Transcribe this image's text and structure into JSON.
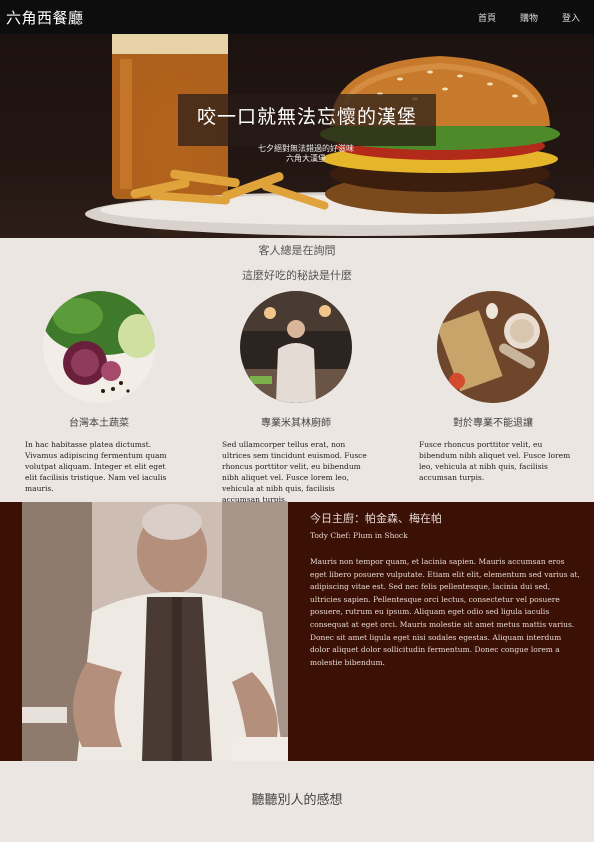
{
  "nav": {
    "brand": "六角西餐廳",
    "links": [
      "首頁",
      "購物",
      "登入"
    ]
  },
  "hero": {
    "title": "咬一口就無法忘懷的漢堡",
    "subtitle_line1": "七夕絕對無法錯過的好滋味",
    "subtitle_line2": "六角大漢堡"
  },
  "features": {
    "heading1": "客人總是在詢問",
    "heading2": "這麼好吃的秘訣是什麼",
    "items": [
      {
        "title": "台灣本土蔬菜",
        "text": "In hac habitasse platea dictumst. Vivamus adipiscing fermentum quam volutpat aliquam. Integer et elit eget elit facilisis tristique. Nam vel iaculis mauris."
      },
      {
        "title": "專業米其林廚師",
        "text": "Sed ullamcorper tellus erat, non ultrices sem tincidunt euismod. Fusce rhoncus porttitor velit, eu bibendum nibh aliquet vel. Fusce lorem leo, vehicula at nibh quis, facilisis accumsan turpis."
      },
      {
        "title": "對於專業不能退讓",
        "text": "Fusce rhoncus porttitor velit, eu bibendum nibh aliquet vel. Fusce lorem leo, vehicula at nibh quis, facilisis accumsan turpis."
      }
    ]
  },
  "chef": {
    "title": "今日主廚：帕金森、梅在帕",
    "subtitle": "Tody Chef: Plum in Shock",
    "text": "Mauris non tempor quam, et lacinia sapien. Mauris accumsan eros eget libero posuere vulputate. Etiam elit elit, elementum sed varius at, adipiscing vitae est. Sed nec felis pellentesque, lacinia dui sed, ultricies sapien. Pellentesque orci lectus, consectetur vel posuere posuere, rutrum eu ipsum. Aliquam eget odio sed ligula iaculis consequat at eget orci. Mauris molestie sit amet metus mattis varius. Donec sit amet ligula eget nisi sodales egestas. Aliquam interdum dolor aliquet dolor sollicitudin fermentum. Donec congue lorem a molestie bibendum."
  },
  "testimonials": {
    "heading": "聽聽別人的感想"
  },
  "colors": {
    "nav_bg": "#0d0d0d",
    "page_bg": "#ece6e3",
    "chef_bg": "#3b1106"
  }
}
